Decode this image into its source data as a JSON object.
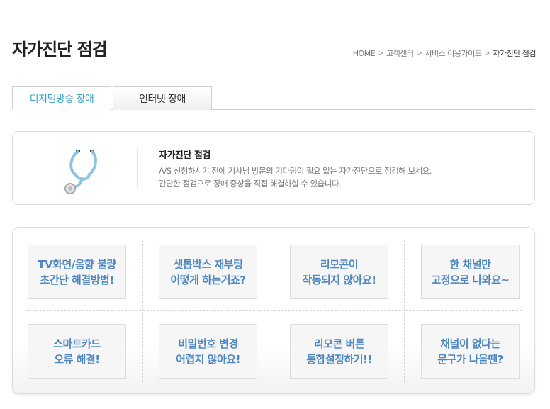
{
  "header": {
    "title": "자가진단 점검",
    "breadcrumb": [
      "HOME",
      "고객센터",
      "서비스 이용가이드",
      "자가진단 점검"
    ]
  },
  "tabs": [
    {
      "label": "디지털방송 장애",
      "active": true
    },
    {
      "label": "인터넷 장애",
      "active": false
    }
  ],
  "intro": {
    "icon": "stethoscope-icon",
    "heading": "자가진단 점검",
    "line1": "A/S 신청하시기 전에 기사님 방문의 기다림이 필요 없는 자가진단으로 점검해 보세요.",
    "line2": "간단한 점검으로 장애 증상을 직접 해결하실 수 있습니다."
  },
  "help_items": [
    {
      "label": "TV화면/음향 불량\n초간단 해결방법!"
    },
    {
      "label": "셋톱박스 재부팅\n어떻게 하는거죠?"
    },
    {
      "label": "리모콘이\n작동되지 않아요!"
    },
    {
      "label": "한 채널만\n고정으로 나와요~"
    },
    {
      "label": "스마트카드\n오류 해결!"
    },
    {
      "label": "비밀번호 변경\n어렵지 않아요!"
    },
    {
      "label": "리모콘 버튼\n통합설정하기!!"
    },
    {
      "label": "채널이 없다는\n문구가 나올땐?"
    }
  ],
  "colors": {
    "accent": "#3aa2c7",
    "button_text": "#4f87c2",
    "border": "#dcdcdc"
  }
}
